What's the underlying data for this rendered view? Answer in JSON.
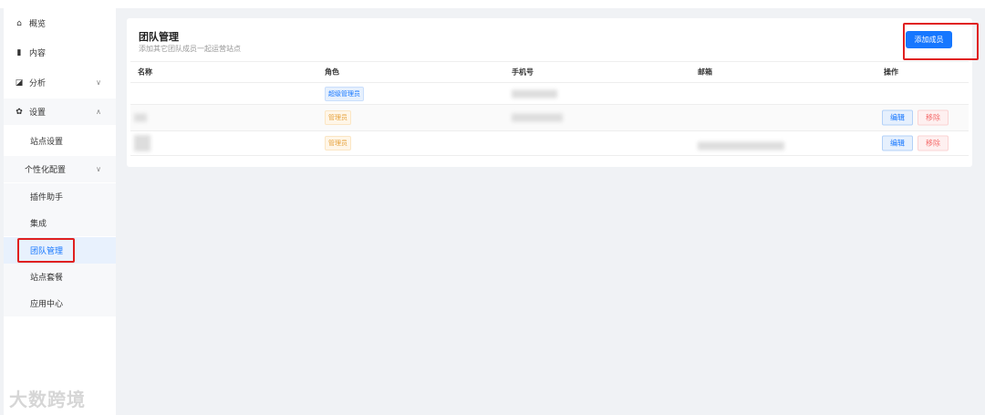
{
  "sidebar": {
    "items": [
      {
        "label": "概览",
        "icon": "home-icon"
      },
      {
        "label": "内容",
        "icon": "content-icon"
      },
      {
        "label": "分析",
        "icon": "chart-icon"
      },
      {
        "label": "设置",
        "icon": "gear-icon"
      },
      {
        "label": "站点设置"
      },
      {
        "label": "个性化配置"
      },
      {
        "label": "插件助手"
      },
      {
        "label": "集成"
      },
      {
        "label": "团队管理"
      },
      {
        "label": "站点套餐"
      },
      {
        "label": "应用中心"
      }
    ]
  },
  "page": {
    "title": "团队管理",
    "subtitle": "添加其它团队成员一起运营站点",
    "add_button": "添加成员"
  },
  "table": {
    "headers": [
      "名称",
      "角色",
      "手机号",
      "邮箱",
      "操作"
    ],
    "rows": [
      {
        "role": "超级管理员"
      },
      {
        "role": "管理员",
        "edit": "编辑",
        "remove": "移除"
      },
      {
        "role": "管理员",
        "edit": "编辑",
        "remove": "移除"
      }
    ]
  },
  "watermark": "大数跨境"
}
